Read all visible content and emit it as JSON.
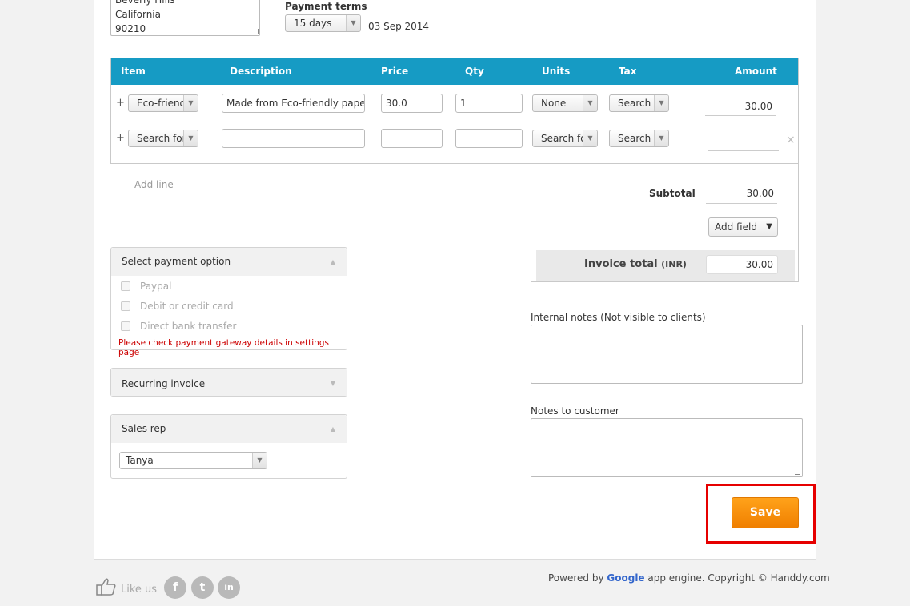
{
  "address": {
    "line1": "Beverly Hills",
    "line2": "California",
    "line3": "90210"
  },
  "payment_terms": {
    "label": "Payment terms",
    "selected": "15 days",
    "due_date": "03 Sep 2014"
  },
  "table": {
    "headers": {
      "item": "Item",
      "description": "Description",
      "price": "Price",
      "qty": "Qty",
      "units": "Units",
      "tax": "Tax",
      "amount": "Amount"
    },
    "rows": [
      {
        "plus": "+",
        "item": "Eco-friendly",
        "description": "Made from Eco-friendly paper",
        "price": "30.0",
        "qty": "1",
        "units": "None",
        "tax": "Search",
        "amount": "30.00"
      },
      {
        "plus": "+",
        "item": "Search for",
        "description": "",
        "price": "",
        "qty": "",
        "units": "Search for",
        "tax": "Search",
        "amount": "",
        "remove": "×"
      }
    ]
  },
  "add_line": "Add line",
  "summary": {
    "subtotal_label": "Subtotal",
    "subtotal_value": "30.00",
    "add_field": "Add field",
    "total_label": "Invoice total",
    "currency": "(INR)",
    "total_value": "30.00"
  },
  "payment_panel": {
    "title": "Select payment option",
    "options": [
      "Paypal",
      "Debit or credit card",
      "Direct bank transfer"
    ],
    "warning": "Please check payment gateway details in settings page"
  },
  "recurring_panel": {
    "title": "Recurring invoice"
  },
  "sales_rep_panel": {
    "title": "Sales rep",
    "selected": "Tanya"
  },
  "internal_notes_label": "Internal notes (Not visible to clients)",
  "customer_notes_label": "Notes to customer",
  "save_label": "Save",
  "footer": {
    "like_us": "Like us",
    "powered_by": "Powered by",
    "google": "Google",
    "powered_rest": "app engine. Copyright © Handdy.com",
    "socials": [
      "f",
      "t",
      "in"
    ]
  },
  "colors": {
    "table_header": "#169bc4",
    "save_button": "#f28a00",
    "highlight": "#e60000",
    "warning": "#cc0000"
  }
}
